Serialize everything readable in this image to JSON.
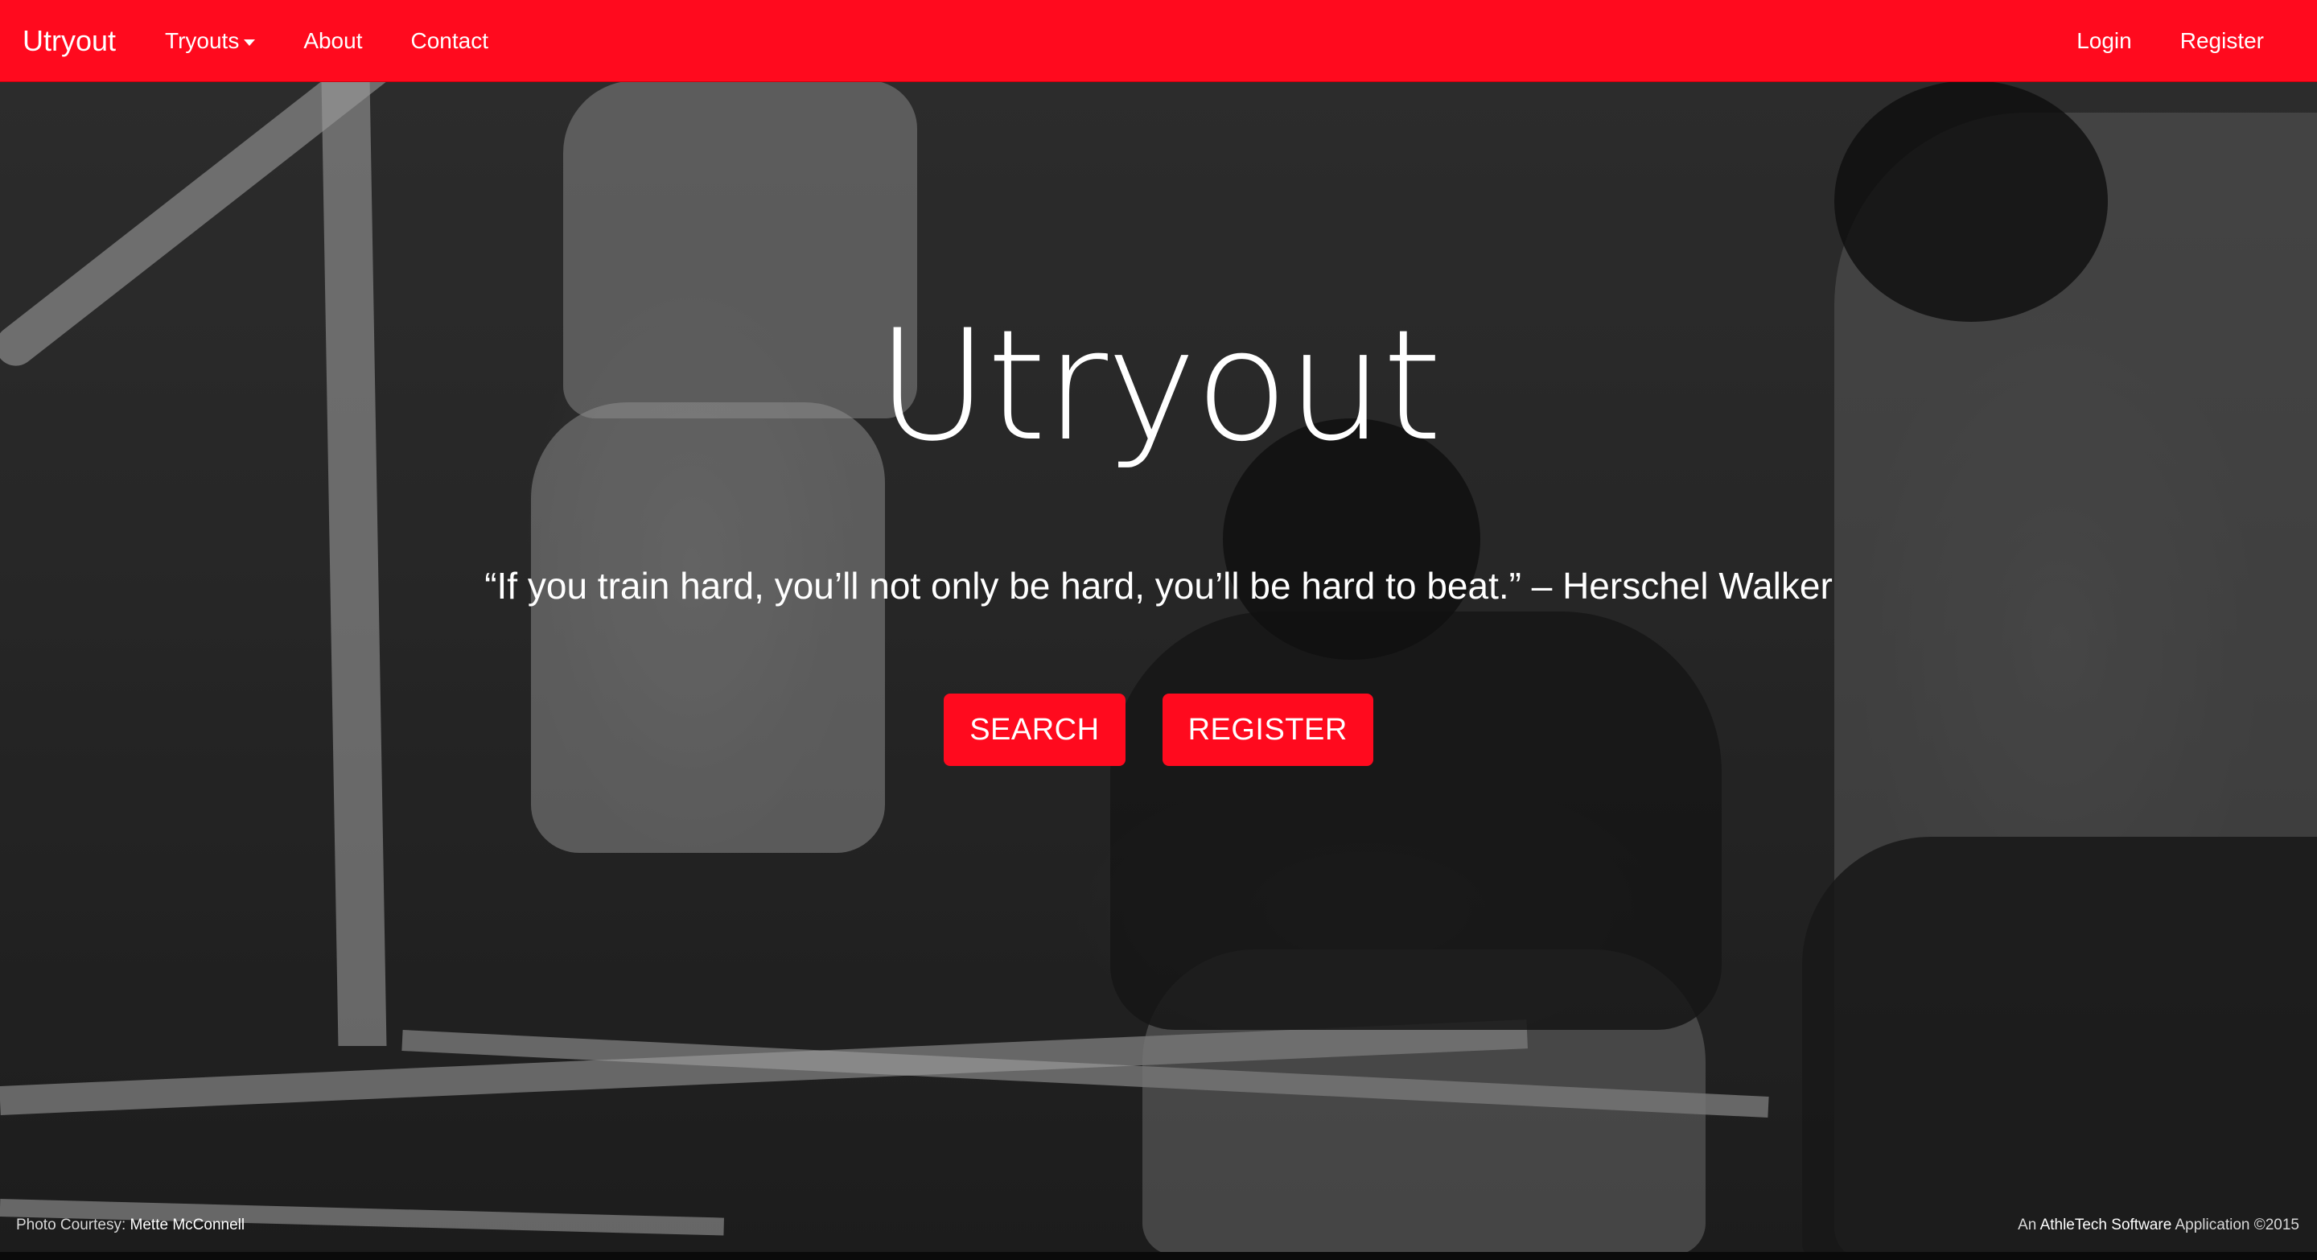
{
  "navbar": {
    "brand": "Utryout",
    "left_items": [
      {
        "label": "Tryouts",
        "has_dropdown": true
      },
      {
        "label": "About"
      },
      {
        "label": "Contact"
      }
    ],
    "right_items": [
      {
        "label": "Login"
      },
      {
        "label": "Register"
      }
    ],
    "background_color": "#ff0a1e"
  },
  "hero": {
    "title": "Utryout",
    "quote": "“If you train hard, you’ll not only be hard, you’ll be hard to beat.” – Herschel Walker",
    "buttons": {
      "search_label": "SEARCH",
      "register_label": "REGISTER"
    },
    "button_color": "#ff0a1e"
  },
  "footer": {
    "photo_label": "Photo Courtesy:",
    "photo_credit": "Mette McConnell",
    "app_prefix": "An",
    "app_company": "AthleTech Software",
    "app_suffix": "Application ©2015"
  }
}
